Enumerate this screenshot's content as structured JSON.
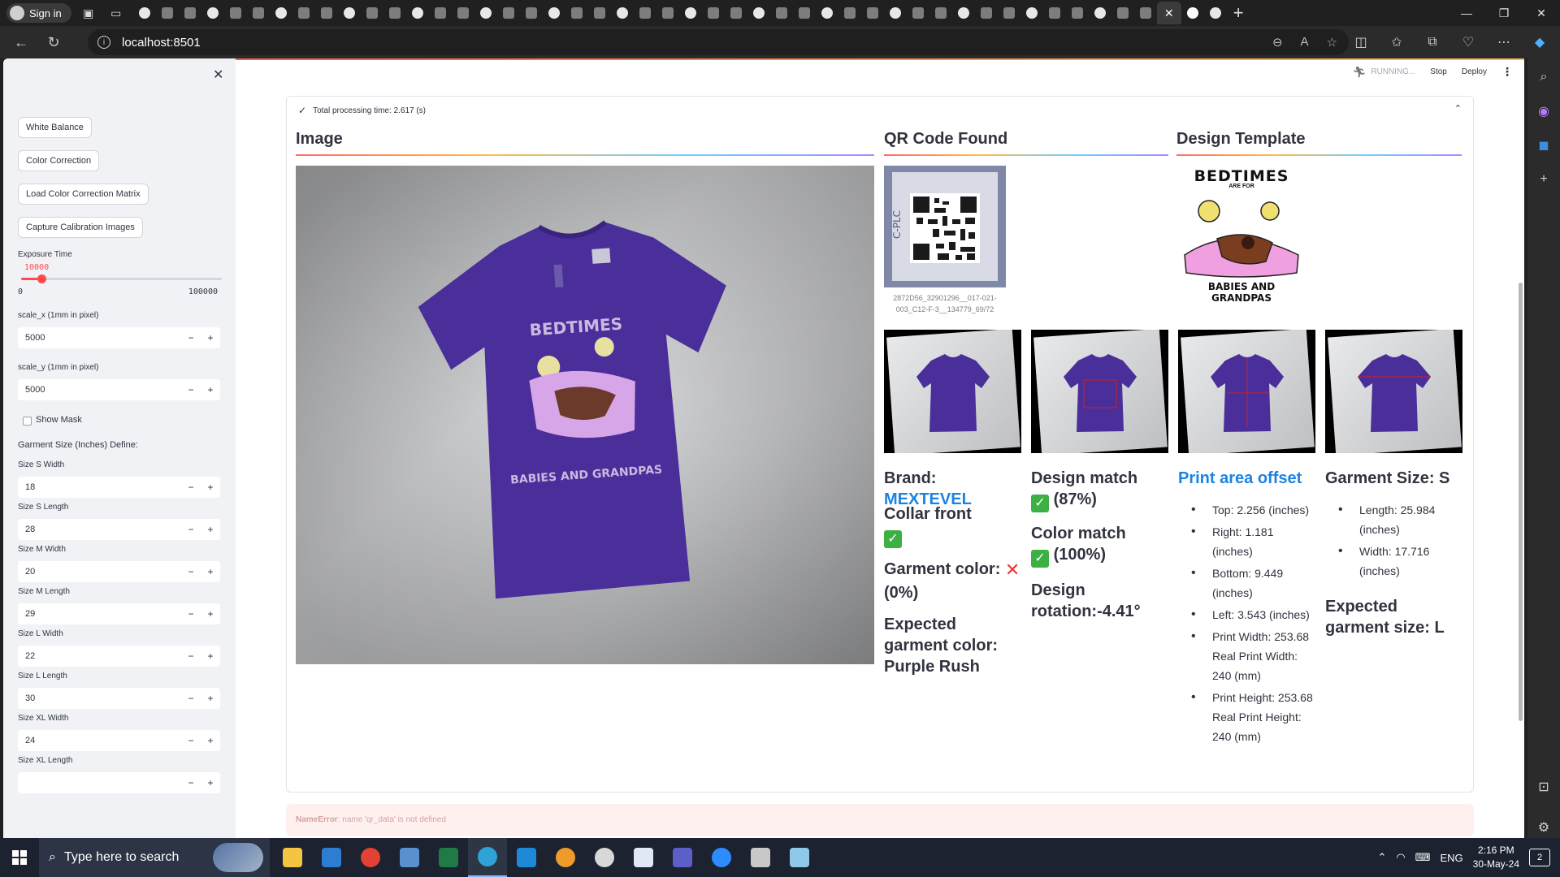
{
  "browser": {
    "signin_label": "Sign in",
    "url": "localhost:8501",
    "tab_icons": [
      "tab-favicon",
      "tab-favicon",
      "tab-favicon",
      "tab-favicon",
      "tab-favicon",
      "tab-favicon",
      "tab-favicon",
      "tab-favicon",
      "tab-favicon",
      "tab-favicon",
      "tab-favicon",
      "tab-favicon",
      "tab-favicon",
      "tab-favicon",
      "tab-favicon",
      "tab-favicon",
      "tab-favicon",
      "tab-favicon",
      "tab-favicon",
      "tab-favicon",
      "tab-favicon",
      "tab-favicon",
      "tab-favicon",
      "tab-favicon",
      "tab-favicon",
      "tab-favicon",
      "tab-favicon",
      "tab-favicon",
      "tab-favicon",
      "tab-favicon",
      "tab-favicon",
      "tab-favicon",
      "tab-favicon",
      "tab-favicon",
      "tab-favicon",
      "tab-favicon",
      "tab-favicon",
      "tab-favicon",
      "tab-favicon",
      "tab-favicon",
      "tab-favicon",
      "tab-favicon",
      "tab-favicon",
      "tab-favicon",
      "tab-favicon",
      "tab-favicon",
      "tab-favicon",
      "tab-favicon",
      "tab-favicon",
      "tab-favicon",
      "tab-favicon",
      "tab-favicon",
      "tab-favicon",
      "tab-favicon",
      "tab-favicon"
    ]
  },
  "sidebar": {
    "buttons": {
      "white_balance": "White Balance",
      "color_correction": "Color Correction",
      "load_ccm": "Load Color Correction Matrix",
      "capture_calibration": "Capture Calibration Images"
    },
    "exposure": {
      "label": "Exposure Time",
      "value": "10000",
      "min": "0",
      "max": "100000",
      "fraction": 0.1
    },
    "scale_x": {
      "label": "scale_x (1mm in pixel)",
      "value": "5000"
    },
    "scale_y": {
      "label": "scale_y (1mm in pixel)",
      "value": "5000"
    },
    "show_mask_label": "Show Mask",
    "garment_define_label": "Garment Size (Inches) Define:",
    "sizes": [
      {
        "label": "Size S Width",
        "value": "18"
      },
      {
        "label": "Size S Length",
        "value": "28"
      },
      {
        "label": "Size M Width",
        "value": "20"
      },
      {
        "label": "Size M Length",
        "value": "29"
      },
      {
        "label": "Size L Width",
        "value": "22"
      },
      {
        "label": "Size L Length",
        "value": "30"
      },
      {
        "label": "Size XL Width",
        "value": "24"
      },
      {
        "label": "Size XL Length",
        "value": ""
      }
    ],
    "step_minus": "−",
    "step_plus": "+"
  },
  "topbar": {
    "running": "RUNNING...",
    "stop": "Stop",
    "deploy": "Deploy"
  },
  "expander": {
    "title": "Total processing time: 2.617 (s)"
  },
  "headers": {
    "image": "Image",
    "qr": "QR Code Found",
    "template": "Design Template"
  },
  "qr_caption": "2872D56_32901296__017-021-003_C12-F-3__134779_69/72",
  "design": {
    "title": "BEDTIMES",
    "subtitle": "ARE FOR",
    "bottom": "BABIES AND GRANDPAS"
  },
  "results": {
    "brand_label": "Brand:",
    "brand_value": "MEXTEVEL",
    "collar": "Collar front",
    "garment_color_label": "Garment color:",
    "garment_color_pct": "(0%)",
    "expected_color": "Expected garment color: Purple Rush",
    "design_match_label": "Design match",
    "design_match_pct": "(87%)",
    "color_match_label": "Color match",
    "color_match_pct": "(100%)",
    "design_rotation": "Design rotation:-4.41°",
    "print_offset_title": "Print area offset",
    "offsets": [
      "Top: 2.256 (inches)",
      "Right: 1.181 (inches)",
      "Bottom: 9.449 (inches)",
      "Left: 3.543 (inches)",
      "Print Width: 253.68 Real Print Width: 240 (mm)",
      "Print Height: 253.68 Real Print Height: 240 (mm)"
    ],
    "garment_size": "Garment Size: S",
    "size_details": [
      "Length: 25.984 (inches)",
      "Width: 17.716 (inches)"
    ],
    "expected_size": "Expected garment size: L"
  },
  "error": {
    "type": "NameError",
    "message": ": name 'qr_data' is not defined"
  },
  "taskbar": {
    "search_placeholder": "Type here to search",
    "lang": "ENG",
    "time": "2:16 PM",
    "date": "30-May-24",
    "notifications": "2"
  },
  "colors": {
    "accent": "#ff4b4b",
    "link_blue": "#1c83e1",
    "shirt": "#4a2e9a"
  }
}
